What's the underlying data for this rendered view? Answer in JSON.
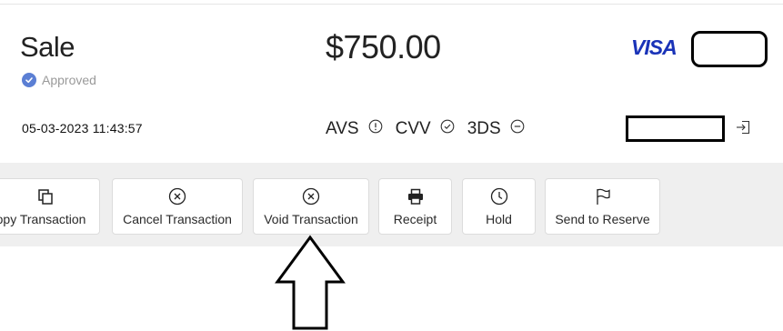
{
  "transaction": {
    "type": "Sale",
    "status": "Approved",
    "amount": "$750.00",
    "card_brand": "VISA",
    "datetime": "05-03-2023 11:43:57"
  },
  "checks": [
    {
      "label": "AVS",
      "icon": "info-circle-icon"
    },
    {
      "label": "CVV",
      "icon": "check-circle-icon"
    },
    {
      "label": "3DS",
      "icon": "minus-circle-icon"
    }
  ],
  "actions": {
    "copy": {
      "label": "Copy Transaction",
      "icon": "copy-icon"
    },
    "cancel": {
      "label": "Cancel Transaction",
      "icon": "x-circle-icon"
    },
    "void": {
      "label": "Void Transaction",
      "icon": "x-circle-icon"
    },
    "receipt": {
      "label": "Receipt",
      "icon": "printer-icon"
    },
    "hold": {
      "label": "Hold",
      "icon": "clock-icon"
    },
    "reserve": {
      "label": "Send to Reserve",
      "icon": "flag-icon"
    }
  },
  "colors": {
    "visa_blue": "#1a33b8",
    "approved_check": "#5b7fd4",
    "action_band": "#efefef"
  }
}
